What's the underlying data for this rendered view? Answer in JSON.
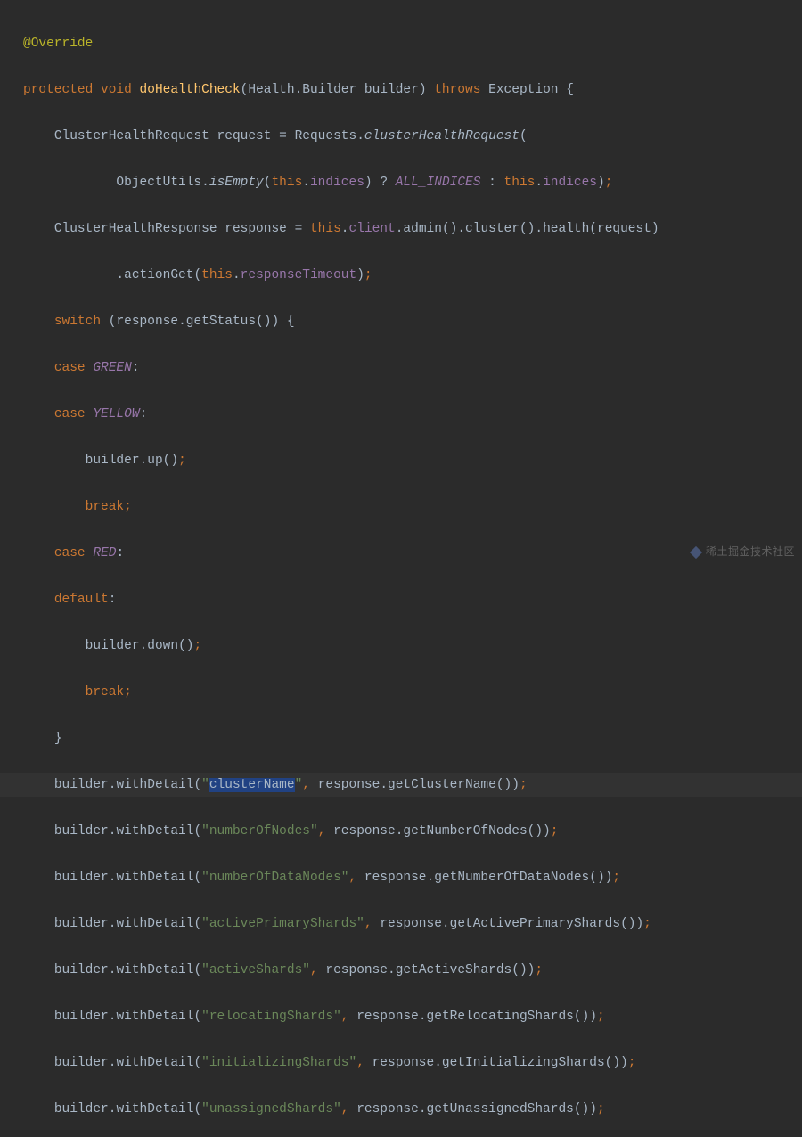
{
  "code": {
    "annotation": "@Override",
    "modifier_protected": "protected",
    "kw_void": "void",
    "method_name": "doHealthCheck",
    "param_type": "Health.Builder",
    "param_name": "builder",
    "kw_throws": "throws",
    "exception": "Exception",
    "brace_open": "{",
    "type_req": "ClusterHealthRequest",
    "var_request": "request",
    "eq": "=",
    "cls_requests": "Requests",
    "m_clusterHealthRequest": "clusterHealthRequest",
    "cls_objectutils": "ObjectUtils",
    "m_isEmpty": "isEmpty",
    "kw_this": "this",
    "f_indices": "indices",
    "q": "?",
    "const_all_indices": "ALL_INDICES",
    "colon": ":",
    "type_resp": "ClusterHealthResponse",
    "var_response": "response",
    "f_client": "client",
    "m_admin": "admin",
    "m_cluster": "cluster",
    "m_health": "health",
    "m_actionGet": "actionGet",
    "f_responseTimeout": "responseTimeout",
    "kw_switch": "switch",
    "m_getStatus": "getStatus",
    "kw_case": "case",
    "const_green": "GREEN",
    "const_yellow": "YELLOW",
    "const_red": "RED",
    "m_up": "up",
    "kw_break": "break",
    "kw_default": "default",
    "m_down": "down",
    "brace_close": "}",
    "m_withDetail": "withDetail",
    "str_clusterName_open": "\"",
    "str_clusterName": "clusterName",
    "str_clusterName_close": "\"",
    "m_getClusterName": "getClusterName",
    "str_numberOfNodes": "\"numberOfNodes\"",
    "m_getNumberOfNodes": "getNumberOfNodes",
    "str_numberOfDataNodes": "\"numberOfDataNodes\"",
    "m_getNumberOfDataNodes": "getNumberOfDataNodes",
    "str_activePrimaryShards": "\"activePrimaryShards\"",
    "m_getActivePrimaryShards": "getActivePrimaryShards",
    "str_activeShards": "\"activeShards\"",
    "m_getActiveShards": "getActiveShards",
    "str_relocatingShards": "\"relocatingShards\"",
    "m_getRelocatingShards": "getRelocatingShards",
    "str_initializingShards": "\"initializingShards\"",
    "m_getInitializingShards": "getInitializingShards",
    "str_unassignedShards": "\"unassignedShards\"",
    "m_getUnassignedShards": "getUnassignedShards",
    "builder": "builder"
  },
  "watermark": "稀土掘金技术社区"
}
